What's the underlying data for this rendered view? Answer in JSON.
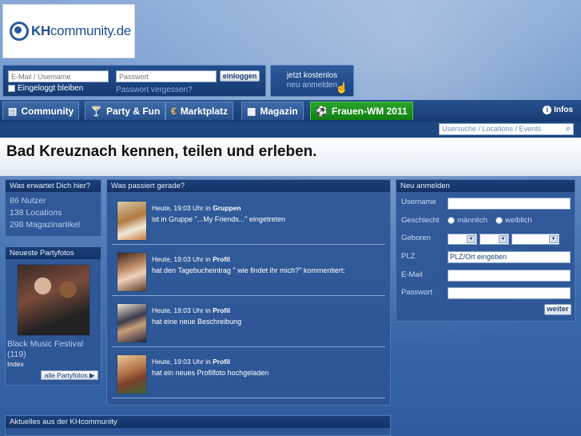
{
  "logo": {
    "brand": "KH",
    "rest": "community.de"
  },
  "login": {
    "email_placeholder": "E-Mail / Username",
    "password_placeholder": "Passwort",
    "login_label": "einloggen",
    "remember_label": "Eingeloggt bleiben",
    "forgot_label": "Passwort vergessen?"
  },
  "register_button": {
    "line1": "jetzt kostenlos",
    "line2": "neu anmelden"
  },
  "nav": {
    "tabs": [
      {
        "label": "Community",
        "icon": "chat-icon"
      },
      {
        "label": "Party & Fun",
        "icon": "cocktail-icon"
      },
      {
        "label": "Marktplatz",
        "icon": "euro-icon"
      },
      {
        "label": "Magazin",
        "icon": "newspaper-icon"
      },
      {
        "label": "Frauen-WM 2011",
        "icon": "soccer-ball-icon"
      }
    ],
    "infos_label": "Infos"
  },
  "search": {
    "placeholder": "Usersuche / Locations / Events"
  },
  "headline": "Bad Kreuznach kennen, teilen und erleben.",
  "was_erwartet": {
    "title": "Was erwartet Dich hier?",
    "stats": [
      "86 Nutzer",
      "138 Locations",
      "298 Magazinartikel"
    ]
  },
  "partyfotos": {
    "title": "Neueste Partyfotos",
    "event_title": "Black Music Festival",
    "count": "(119)",
    "index": "Index",
    "all_label": "alle Partyfotos"
  },
  "feed": {
    "title": "Was passiert gerade?",
    "items": [
      {
        "time": "Heute, 19:03 Uhr in",
        "category": "Gruppen",
        "text": "ist in Gruppe \"...My Friends...\" eingetreten"
      },
      {
        "time": "Heute, 19:03 Uhr in",
        "category": "Profil",
        "text": "hat den Tagebucheintrag \" wie findet ihr mich?\" kommentiert:"
      },
      {
        "time": "Heute, 19:03 Uhr in",
        "category": "Profil",
        "text": "hat eine neue Beschreibung"
      },
      {
        "time": "Heute, 19:03 Uhr in",
        "category": "Profil",
        "text": "hat ein neues Profilfoto hochgeladen"
      }
    ]
  },
  "register_form": {
    "title": "Neu anmelden",
    "username_label": "Username",
    "gender_label": "Geschlecht",
    "male": "männlich",
    "female": "weiblich",
    "birth_label": "Geboren",
    "plz_label": "PLZ",
    "plz_value": "PLZ/Ort eingeben",
    "email_label": "E-Mail",
    "password_label": "Passwort",
    "submit_label": "weiter"
  },
  "aktuelles": {
    "title": "Aktuelles aus der KHcommunity"
  }
}
